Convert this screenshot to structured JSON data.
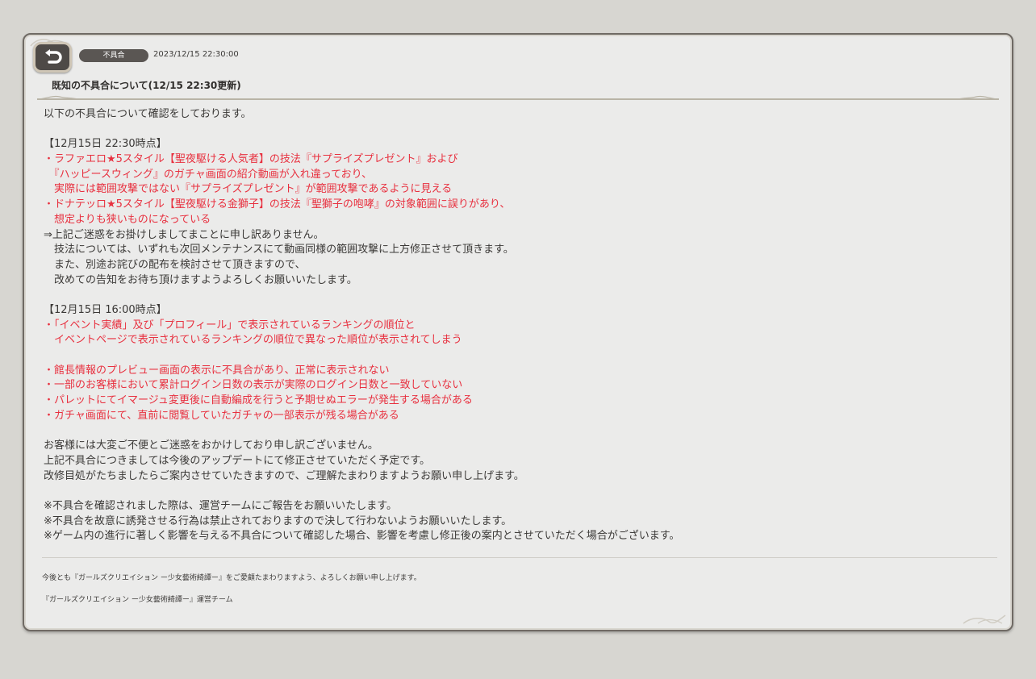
{
  "header": {
    "back_icon": "return-arrow-icon",
    "tag": "不具合",
    "date": "2023/12/15 22:30:00",
    "title": "既知の不具合について(12/15 22:30更新)"
  },
  "colors": {
    "accent_red": "#e8303f",
    "text": "#3a3836",
    "panel": "#ebebea"
  },
  "content": {
    "lines": [
      {
        "text": "以下の不具合について確認をしております。",
        "color": "normal"
      },
      {
        "text": "",
        "color": "normal"
      },
      {
        "text": "【12月15日 22:30時点】",
        "color": "normal"
      },
      {
        "text": "・ラファエロ★5スタイル【聖夜駆ける人気者】の技法『サプライズプレゼント』および",
        "color": "red"
      },
      {
        "text": "　『ハッピースウィング』のガチャ画面の紹介動画が入れ違っており、",
        "color": "red"
      },
      {
        "text": "　実際には範囲攻撃ではない『サプライズプレゼント』が範囲攻撃であるように見える",
        "color": "red"
      },
      {
        "text": "・ドナテッロ★5スタイル【聖夜駆ける金獅子】の技法『聖獅子の咆哮』の対象範囲に誤りがあり、",
        "color": "red"
      },
      {
        "text": "　想定よりも狭いものになっている",
        "color": "red"
      },
      {
        "text": "⇒上記ご迷惑をお掛けしましてまことに申し訳ありません。",
        "color": "normal"
      },
      {
        "text": "　技法については、いずれも次回メンテナンスにて動画同様の範囲攻撃に上方修正させて頂きます。",
        "color": "normal"
      },
      {
        "text": "　また、別途お詫びの配布を検討させて頂きますので、",
        "color": "normal"
      },
      {
        "text": "　改めての告知をお待ち頂けますようよろしくお願いいたします。",
        "color": "normal"
      },
      {
        "text": "",
        "color": "normal"
      },
      {
        "text": "【12月15日 16:00時点】",
        "color": "normal"
      },
      {
        "text": "・「イベント実績」及び「プロフィール」で表示されているランキングの順位と",
        "color": "red"
      },
      {
        "text": "　イベントページで表示されているランキングの順位で異なった順位が表示されてしまう",
        "color": "red"
      },
      {
        "text": "",
        "color": "normal"
      },
      {
        "text": "・館長情報のプレビュー画面の表示に不具合があり、正常に表示されない",
        "color": "red"
      },
      {
        "text": "・一部のお客様において累計ログイン日数の表示が実際のログイン日数と一致していない",
        "color": "red"
      },
      {
        "text": "・パレットにてイマージュ変更後に自動編成を行うと予期せぬエラーが発生する場合がある",
        "color": "red"
      },
      {
        "text": "・ガチャ画面にて、直前に閲覧していたガチャの一部表示が残る場合がある",
        "color": "red"
      },
      {
        "text": "",
        "color": "normal"
      },
      {
        "text": "お客様には大変ご不便とご迷惑をおかけしており申し訳ございません。",
        "color": "normal"
      },
      {
        "text": "上記不具合につきましては今後のアップデートにて修正させていただく予定です。",
        "color": "normal"
      },
      {
        "text": "改修目処がたちましたらご案内させていたきますので、ご理解たまわりますようお願い申し上げます。",
        "color": "normal"
      },
      {
        "text": "",
        "color": "normal"
      },
      {
        "text": "※不具合を確認されました際は、運営チームにご報告をお願いいたします。",
        "color": "normal"
      },
      {
        "text": "※不具合を故意に誘発させる行為は禁止されておりますので決して行わないようお願いいたします。",
        "color": "normal"
      },
      {
        "text": "※ゲーム内の進行に著しく影響を与える不具合について確認した場合、影響を考慮し修正後の案内とさせていただく場合がございます。",
        "color": "normal"
      }
    ]
  },
  "footer": {
    "closing": "今後とも『ガールズクリエイション ー少女藝術綺譚ー』をご愛顧たまわりますよう、よろしくお願い申し上げます。",
    "team": "『ガールズクリエイション ー少女藝術綺譚ー』運営チーム"
  }
}
